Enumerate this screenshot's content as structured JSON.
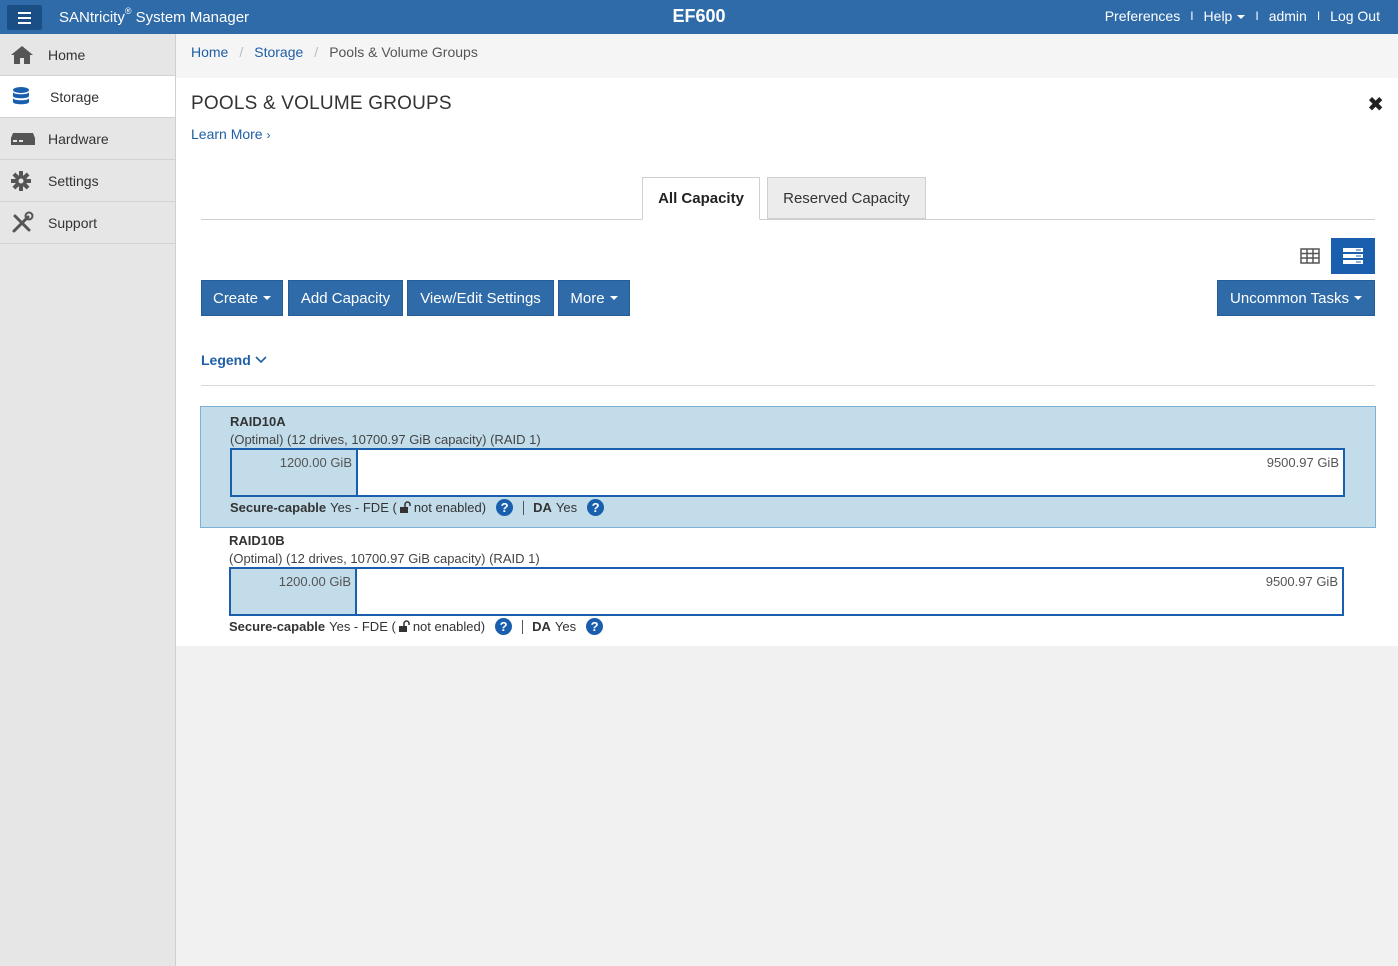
{
  "header": {
    "menu_icon": "hamburger-icon",
    "app_name": "SANtricity",
    "app_reg": "®",
    "app_suffix": "System Manager",
    "system_name": "EF600",
    "links": {
      "preferences": "Preferences",
      "help": "Help",
      "user": "admin",
      "logout": "Log Out"
    },
    "colors": {
      "bar": "#2f6ba8",
      "menu_button": "#1a4f86"
    }
  },
  "sidebar": {
    "items": [
      {
        "label": "Home",
        "icon": "home-icon",
        "active": false
      },
      {
        "label": "Storage",
        "icon": "database-icon",
        "active": true
      },
      {
        "label": "Hardware",
        "icon": "hardware-icon",
        "active": false
      },
      {
        "label": "Settings",
        "icon": "gear-icon",
        "active": false
      },
      {
        "label": "Support",
        "icon": "tools-icon",
        "active": false
      }
    ]
  },
  "breadcrumb": {
    "home": "Home",
    "storage": "Storage",
    "current": "Pools & Volume Groups"
  },
  "page": {
    "title": "POOLS & VOLUME GROUPS",
    "learn_more": "Learn More",
    "close_icon": "close-icon"
  },
  "tabs": {
    "all_capacity": "All Capacity",
    "reserved_capacity": "Reserved Capacity",
    "active": "All Capacity"
  },
  "view_toggle": {
    "table_icon": "table-view-icon",
    "list_icon": "list-view-icon",
    "active": "list"
  },
  "toolbar": {
    "create": "Create",
    "add_capacity": "Add Capacity",
    "view_edit": "View/Edit Settings",
    "more": "More",
    "uncommon": "Uncommon Tasks"
  },
  "legend": {
    "label": "Legend"
  },
  "groups": [
    {
      "name": "RAID10A",
      "description": "(Optimal) (12 drives, 10700.97 GiB capacity) (RAID 1)",
      "used_label": "1200.00 GiB",
      "free_label": "9500.97 GiB",
      "secure_label": "Secure-capable",
      "secure_value": "Yes - FDE (",
      "secure_tail": "not enabled)",
      "da_label": "DA",
      "da_value": "Yes",
      "selected": true
    },
    {
      "name": "RAID10B",
      "description": "(Optimal) (12 drives, 10700.97 GiB capacity) (RAID 1)",
      "used_label": "1200.00 GiB",
      "free_label": "9500.97 GiB",
      "secure_label": "Secure-capable",
      "secure_value": "Yes - FDE (",
      "secure_tail": "not enabled)",
      "da_label": "DA",
      "da_value": "Yes",
      "selected": false
    }
  ]
}
